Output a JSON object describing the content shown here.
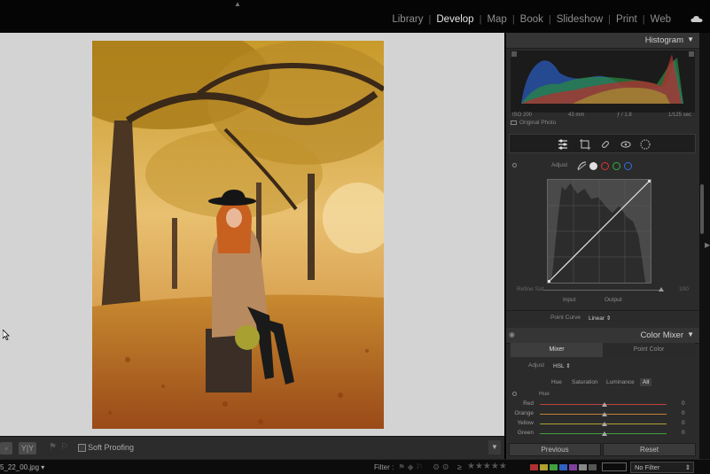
{
  "top_bar": {
    "modules": [
      "Library",
      "Develop",
      "Map",
      "Book",
      "Slideshow",
      "Print",
      "Web"
    ],
    "active_module": "Develop"
  },
  "histogram": {
    "title": "Histogram",
    "iso": "ISO 200",
    "focal": "43 mm",
    "aperture": "ƒ / 1.8",
    "shutter": "1/125 sec",
    "original_photo": "Original Photo"
  },
  "tone_curve": {
    "adjust_label": "Adjust",
    "refine_label": "Refine Sat.",
    "refine_value": "100",
    "input_label": "Input",
    "output_label": "Output",
    "point_curve_label": "Point Curve",
    "point_curve_value": "Linear",
    "channel_colors": [
      "#d8d8d8",
      "#e03030",
      "#30b040",
      "#3070e0"
    ]
  },
  "color_mixer": {
    "title": "Color Mixer",
    "tabs": [
      "Mixer",
      "Point Color"
    ],
    "active_tab": "Mixer",
    "adjust_label": "Adjust",
    "adjust_value": "HSL",
    "hsl_tabs": [
      "Hue",
      "Saturation",
      "Luminance",
      "All"
    ],
    "active_hsl_tab": "All",
    "group_label": "Hue",
    "sliders": [
      {
        "label": "Red",
        "value": "0",
        "color": "#c04040"
      },
      {
        "label": "Orange",
        "value": "0",
        "color": "#c08030"
      },
      {
        "label": "Yellow",
        "value": "0",
        "color": "#b0a030"
      },
      {
        "label": "Green",
        "value": "0",
        "color": "#40a040"
      }
    ]
  },
  "buttons": {
    "previous": "Previous",
    "reset": "Reset"
  },
  "toolbar": {
    "soft_proofing": "Soft Proofing"
  },
  "status_bar": {
    "filename": "5_22_00.jpg",
    "filter_label": "Filter :",
    "stars": "★★★★★",
    "color_labels": [
      "#b03030",
      "#b0a030",
      "#40a040",
      "#3060c0",
      "#8040a0",
      "#888888",
      "#555555"
    ],
    "filter_preset": "No Filter"
  }
}
